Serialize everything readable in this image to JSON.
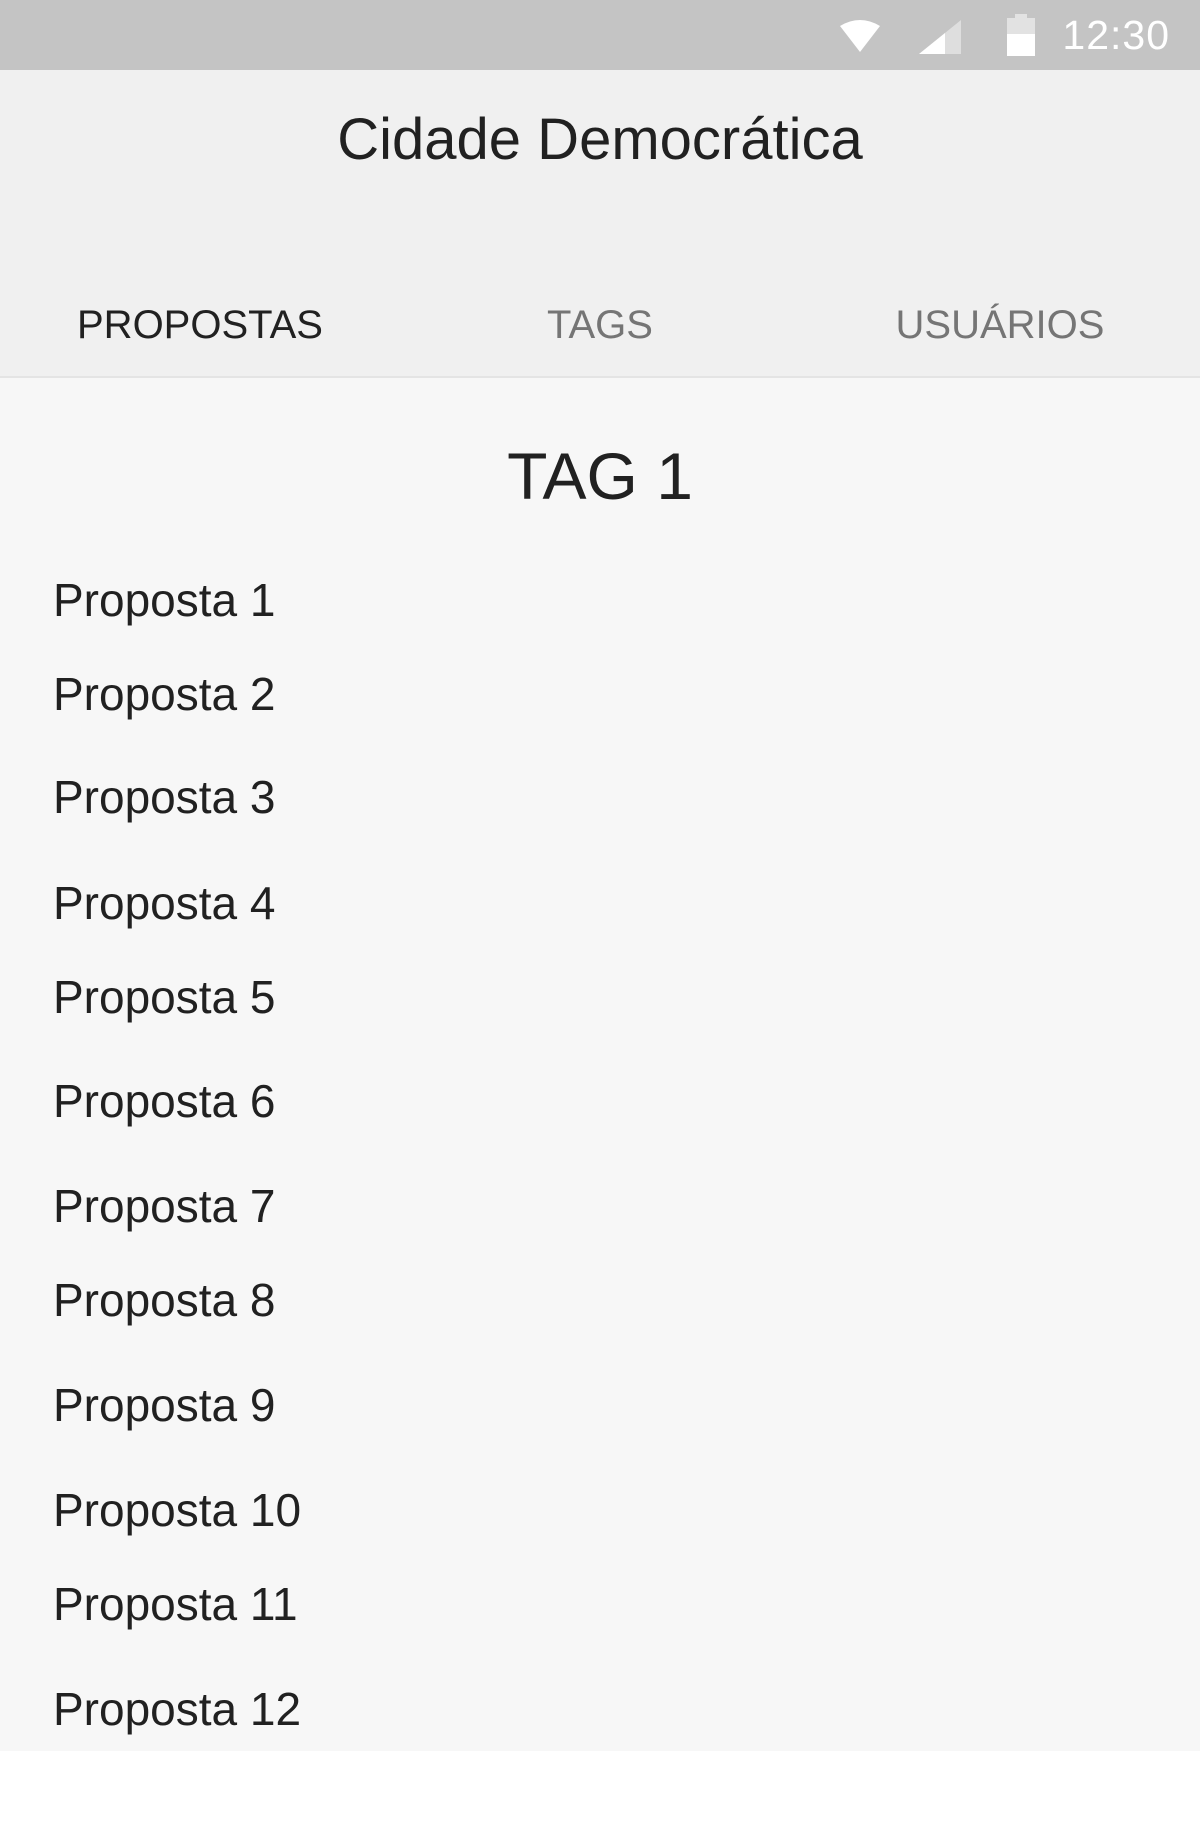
{
  "status_bar": {
    "time": "12:30",
    "icons": [
      "wifi-icon",
      "signal-icon",
      "battery-icon"
    ]
  },
  "app_bar": {
    "title": "Cidade Democrática"
  },
  "tabs": [
    {
      "label": "PROPOSTAS",
      "active": true
    },
    {
      "label": "TAGS",
      "active": false
    },
    {
      "label": "USUÁRIOS",
      "active": false
    }
  ],
  "content": {
    "tag_title": "TAG 1",
    "proposals": [
      "Proposta 1",
      "Proposta 2",
      "Proposta 3",
      "Proposta 4",
      "Proposta 5",
      "Proposta 6",
      "Proposta 7",
      "Proposta 8",
      "Proposta 9",
      "Proposta 10",
      "Proposta 11",
      "Proposta 12"
    ]
  },
  "colors": {
    "status_bar": "#c4c4c4",
    "app_bar": "#f0f0f0",
    "content_background": "#f7f7f7",
    "active_tab_text": "#212121",
    "inactive_tab_text": "#757575"
  }
}
